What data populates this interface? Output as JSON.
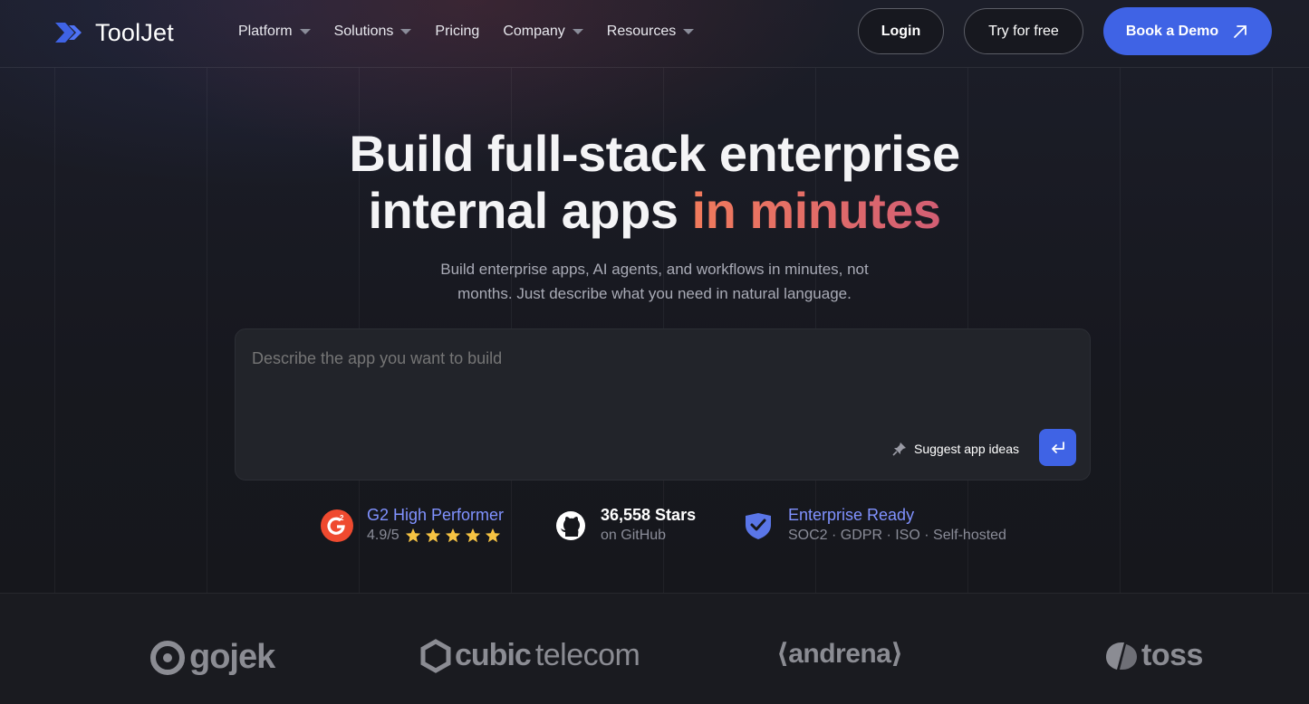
{
  "brand": {
    "name": "ToolJet",
    "accent_color": "#3f63e5"
  },
  "nav": {
    "items": [
      {
        "label": "Platform",
        "has_dropdown": true
      },
      {
        "label": "Solutions",
        "has_dropdown": true
      },
      {
        "label": "Pricing",
        "has_dropdown": false
      },
      {
        "label": "Company",
        "has_dropdown": true
      },
      {
        "label": "Resources",
        "has_dropdown": true
      }
    ],
    "login_label": "Login",
    "try_label": "Try for free",
    "demo_label": "Book a Demo"
  },
  "hero": {
    "title_line1": "Build full-stack enterprise",
    "title_line2_plain": "internal apps ",
    "title_line2_accent": "in minutes",
    "accent_color": "#e8705e",
    "subtitle_line1": "Build enterprise apps, AI agents, and workflows in minutes, not",
    "subtitle_line2": "months. Just describe what you need in natural language."
  },
  "prompt": {
    "placeholder": "Describe the app you want to build",
    "suggest_label": "Suggest app ideas"
  },
  "badges": {
    "g2": {
      "title": "G2 High Performer",
      "rating": "4.9/5",
      "stars": 5
    },
    "github": {
      "title": "36,558 Stars",
      "sub": "on GitHub"
    },
    "enterprise": {
      "title": "Enterprise Ready",
      "sub": "SOC2 · GDPR · ISO · Self-hosted"
    }
  },
  "customers": [
    {
      "name": "gojek"
    },
    {
      "name_bold": "cubic",
      "name_light": "telecom"
    },
    {
      "name": "⟨andrena⟩"
    },
    {
      "name": "toss"
    }
  ]
}
